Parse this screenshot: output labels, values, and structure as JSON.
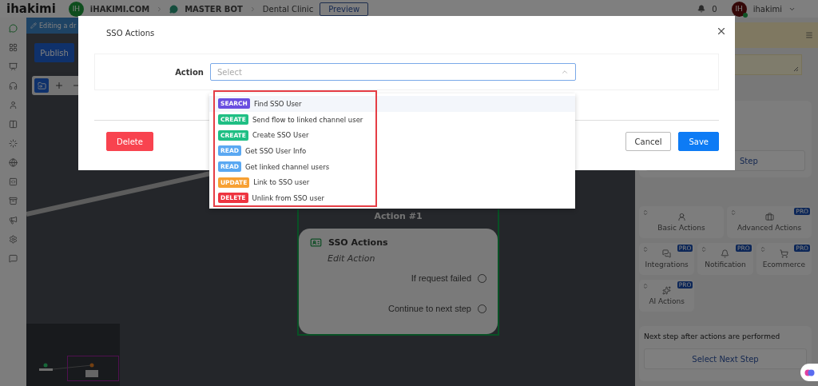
{
  "topbar": {
    "logo": "ihakimi",
    "workspace_initials": "IH",
    "breadcrumb": [
      "iHAKIMI.COM",
      "MASTER BOT",
      "Dental Clinic"
    ],
    "preview_button": "Preview",
    "notifications": "0",
    "user": {
      "initials": "IH",
      "name": "ihakimi",
      "online": true
    }
  },
  "editor": {
    "draft_notice": "Editing a dr",
    "publish_button": "Publish"
  },
  "canvas": {
    "node": {
      "title": "Action #1",
      "card_title": "SSO Actions",
      "card_subtitle": "Edit Action",
      "outputs": [
        "If request failed",
        "Continue to next step"
      ]
    }
  },
  "right_panel": {
    "step_button": "Step",
    "action_groups": [
      {
        "kind": "basic",
        "label": "Basic Actions"
      },
      {
        "kind": "advanced",
        "label": "Advanced Actions",
        "badge": "PRO"
      },
      {
        "kind": "integrations",
        "label": "Integrations",
        "badge": "PRO"
      },
      {
        "kind": "notification",
        "label": "Notification",
        "badge": "PRO"
      },
      {
        "kind": "ecommerce",
        "label": "Ecommerce",
        "badge": "PRO"
      },
      {
        "kind": "ai",
        "label": "AI Actions",
        "badge": "PRO"
      }
    ],
    "next_step": {
      "label": "Next step after actions are performed",
      "button": "Select Next Step"
    }
  },
  "modal": {
    "title": "SSO Actions",
    "field_label": "Action",
    "placeholder": "Select",
    "expanded": true,
    "options": [
      {
        "badge": "SEARCH",
        "color": "#6a4fe0",
        "label": "Find SSO User",
        "highlighted": true
      },
      {
        "badge": "CREATE",
        "color": "#1fbf84",
        "label": "Send flow to linked channel user",
        "highlighted": false
      },
      {
        "badge": "CREATE",
        "color": "#1fbf84",
        "label": "Create SSO User",
        "highlighted": false
      },
      {
        "badge": "READ",
        "color": "#5aa8f2",
        "label": "Get SSO User Info",
        "highlighted": false
      },
      {
        "badge": "READ",
        "color": "#5aa8f2",
        "label": "Get linked channel users",
        "highlighted": false
      },
      {
        "badge": "UPDATE",
        "color": "#f7a033",
        "label": "Link to SSO user",
        "highlighted": false
      },
      {
        "badge": "DELETE",
        "color": "#ee3440",
        "label": "Unlink from SSO user",
        "highlighted": false
      }
    ],
    "delete_button": "Delete",
    "cancel_button": "Cancel",
    "save_button": "Save"
  }
}
